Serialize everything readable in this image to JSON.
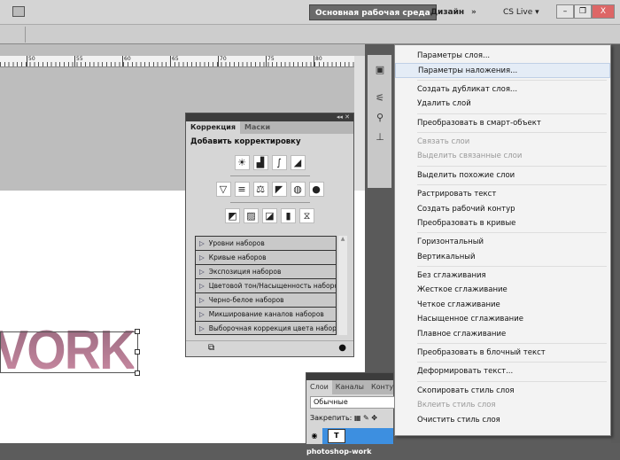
{
  "topbar": {
    "workspace_main": "Основная рабочая среда",
    "workspace_design": "Дизайн",
    "more": "»",
    "cslive": "CS Live ▾",
    "minimize": "–",
    "restore": "❐",
    "close": "X"
  },
  "ruler": {
    "labels": [
      "50",
      "55",
      "60",
      "65",
      "70",
      "75",
      "80"
    ]
  },
  "canvas": {
    "text": "VORK"
  },
  "correction_panel": {
    "tabs": [
      "Коррекция",
      "Маски"
    ],
    "title": "Добавить корректировку",
    "collapse": "◂◂ ✕",
    "presets": [
      "Уровни наборов",
      "Кривые наборов",
      "Экспозиция наборов",
      "Цветовой тон/Насыщенность наборов",
      "Черно-белое наборов",
      "Микширование каналов наборов",
      "Выборочная коррекция цвета наборов"
    ]
  },
  "layers_panel": {
    "tabs": [
      "Слои",
      "Каналы",
      "Контур"
    ],
    "blend_mode": "Обычные",
    "lock_label": "Закрепить:",
    "layer_name": "photoshop-work"
  },
  "context_menu": {
    "items": [
      {
        "label": "Параметры слоя...",
        "state": "normal"
      },
      {
        "label": "Параметры наложения...",
        "state": "highlighted"
      },
      {
        "sep": true
      },
      {
        "label": "Создать дубликат слоя...",
        "state": "normal"
      },
      {
        "label": "Удалить слой",
        "state": "normal"
      },
      {
        "sep": true
      },
      {
        "label": "Преобразовать в смарт-объект",
        "state": "normal"
      },
      {
        "sep": true
      },
      {
        "label": "Связать слои",
        "state": "disabled"
      },
      {
        "label": "Выделить связанные слои",
        "state": "disabled"
      },
      {
        "sep": true
      },
      {
        "label": "Выделить похожие слои",
        "state": "normal"
      },
      {
        "sep": true
      },
      {
        "label": "Растрировать текст",
        "state": "normal"
      },
      {
        "label": "Создать рабочий контур",
        "state": "normal"
      },
      {
        "label": "Преобразовать в кривые",
        "state": "normal"
      },
      {
        "sep": true
      },
      {
        "label": "Горизонтальный",
        "state": "normal"
      },
      {
        "label": "Вертикальный",
        "state": "normal"
      },
      {
        "sep": true
      },
      {
        "label": "Без сглаживания",
        "state": "normal"
      },
      {
        "label": "Жесткое сглаживание",
        "state": "normal"
      },
      {
        "label": "Четкое сглаживание",
        "state": "normal"
      },
      {
        "label": "Насыщенное сглаживание",
        "state": "normal"
      },
      {
        "label": "Плавное сглаживание",
        "state": "normal"
      },
      {
        "sep": true
      },
      {
        "label": "Преобразовать в блочный текст",
        "state": "normal"
      },
      {
        "sep": true
      },
      {
        "label": "Деформировать текст...",
        "state": "normal"
      },
      {
        "sep": true
      },
      {
        "label": "Скопировать стиль слоя",
        "state": "normal"
      },
      {
        "label": "Вклеить стиль слоя",
        "state": "disabled"
      },
      {
        "label": "Очистить стиль слоя",
        "state": "normal"
      }
    ]
  }
}
